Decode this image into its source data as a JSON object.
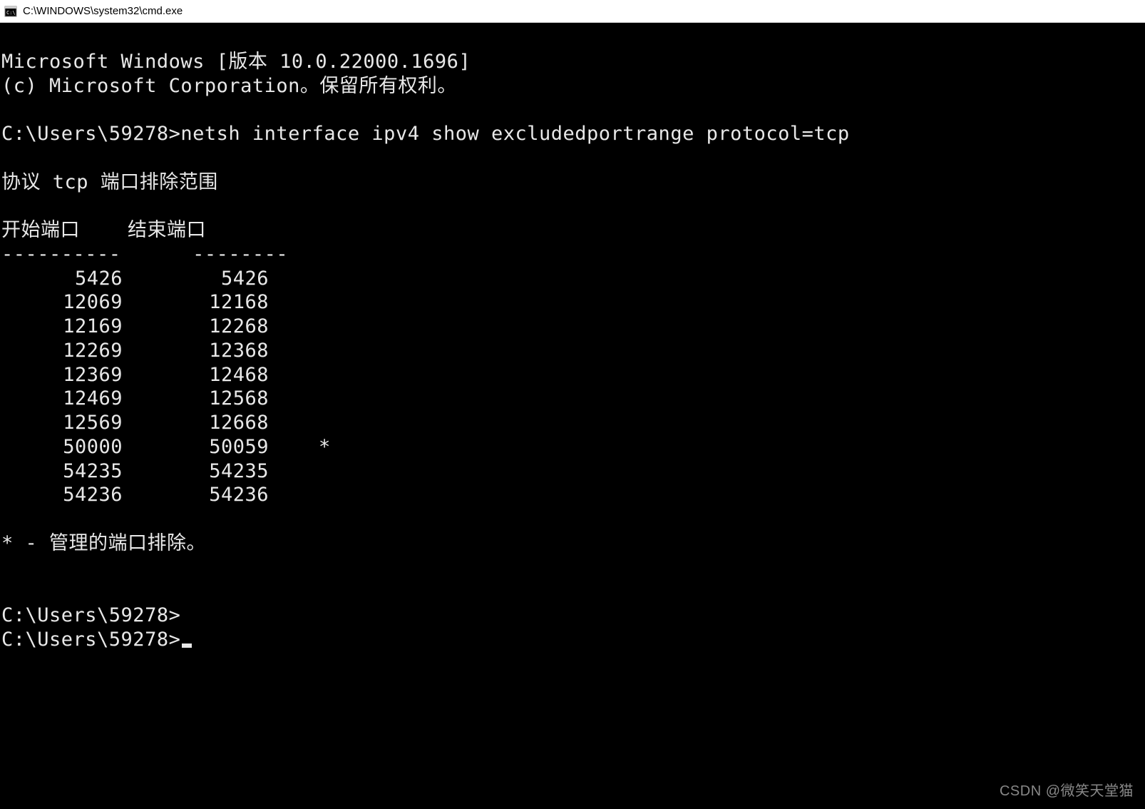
{
  "title_bar": {
    "title": "C:\\WINDOWS\\system32\\cmd.exe"
  },
  "terminal": {
    "header_line1": "Microsoft Windows [版本 10.0.22000.1696]",
    "header_line2": "(c) Microsoft Corporation。保留所有权利。",
    "prompt1": "C:\\Users\\59278>",
    "command1": "netsh interface ipv4 show excludedportrange protocol=tcp",
    "section_title": "协议 tcp 端口排除范围",
    "col_header1": "开始端口",
    "col_header2": "结束端口",
    "divider1": "----------",
    "divider2": "--------",
    "rows": [
      {
        "start": "5426",
        "end": "5426",
        "mark": ""
      },
      {
        "start": "12069",
        "end": "12168",
        "mark": ""
      },
      {
        "start": "12169",
        "end": "12268",
        "mark": ""
      },
      {
        "start": "12269",
        "end": "12368",
        "mark": ""
      },
      {
        "start": "12369",
        "end": "12468",
        "mark": ""
      },
      {
        "start": "12469",
        "end": "12568",
        "mark": ""
      },
      {
        "start": "12569",
        "end": "12668",
        "mark": ""
      },
      {
        "start": "50000",
        "end": "50059",
        "mark": "*"
      },
      {
        "start": "54235",
        "end": "54235",
        "mark": ""
      },
      {
        "start": "54236",
        "end": "54236",
        "mark": ""
      }
    ],
    "footnote": "* - 管理的端口排除。",
    "prompt2": "C:\\Users\\59278>",
    "prompt3": "C:\\Users\\59278>"
  },
  "watermark": "CSDN @微笑天堂猫"
}
